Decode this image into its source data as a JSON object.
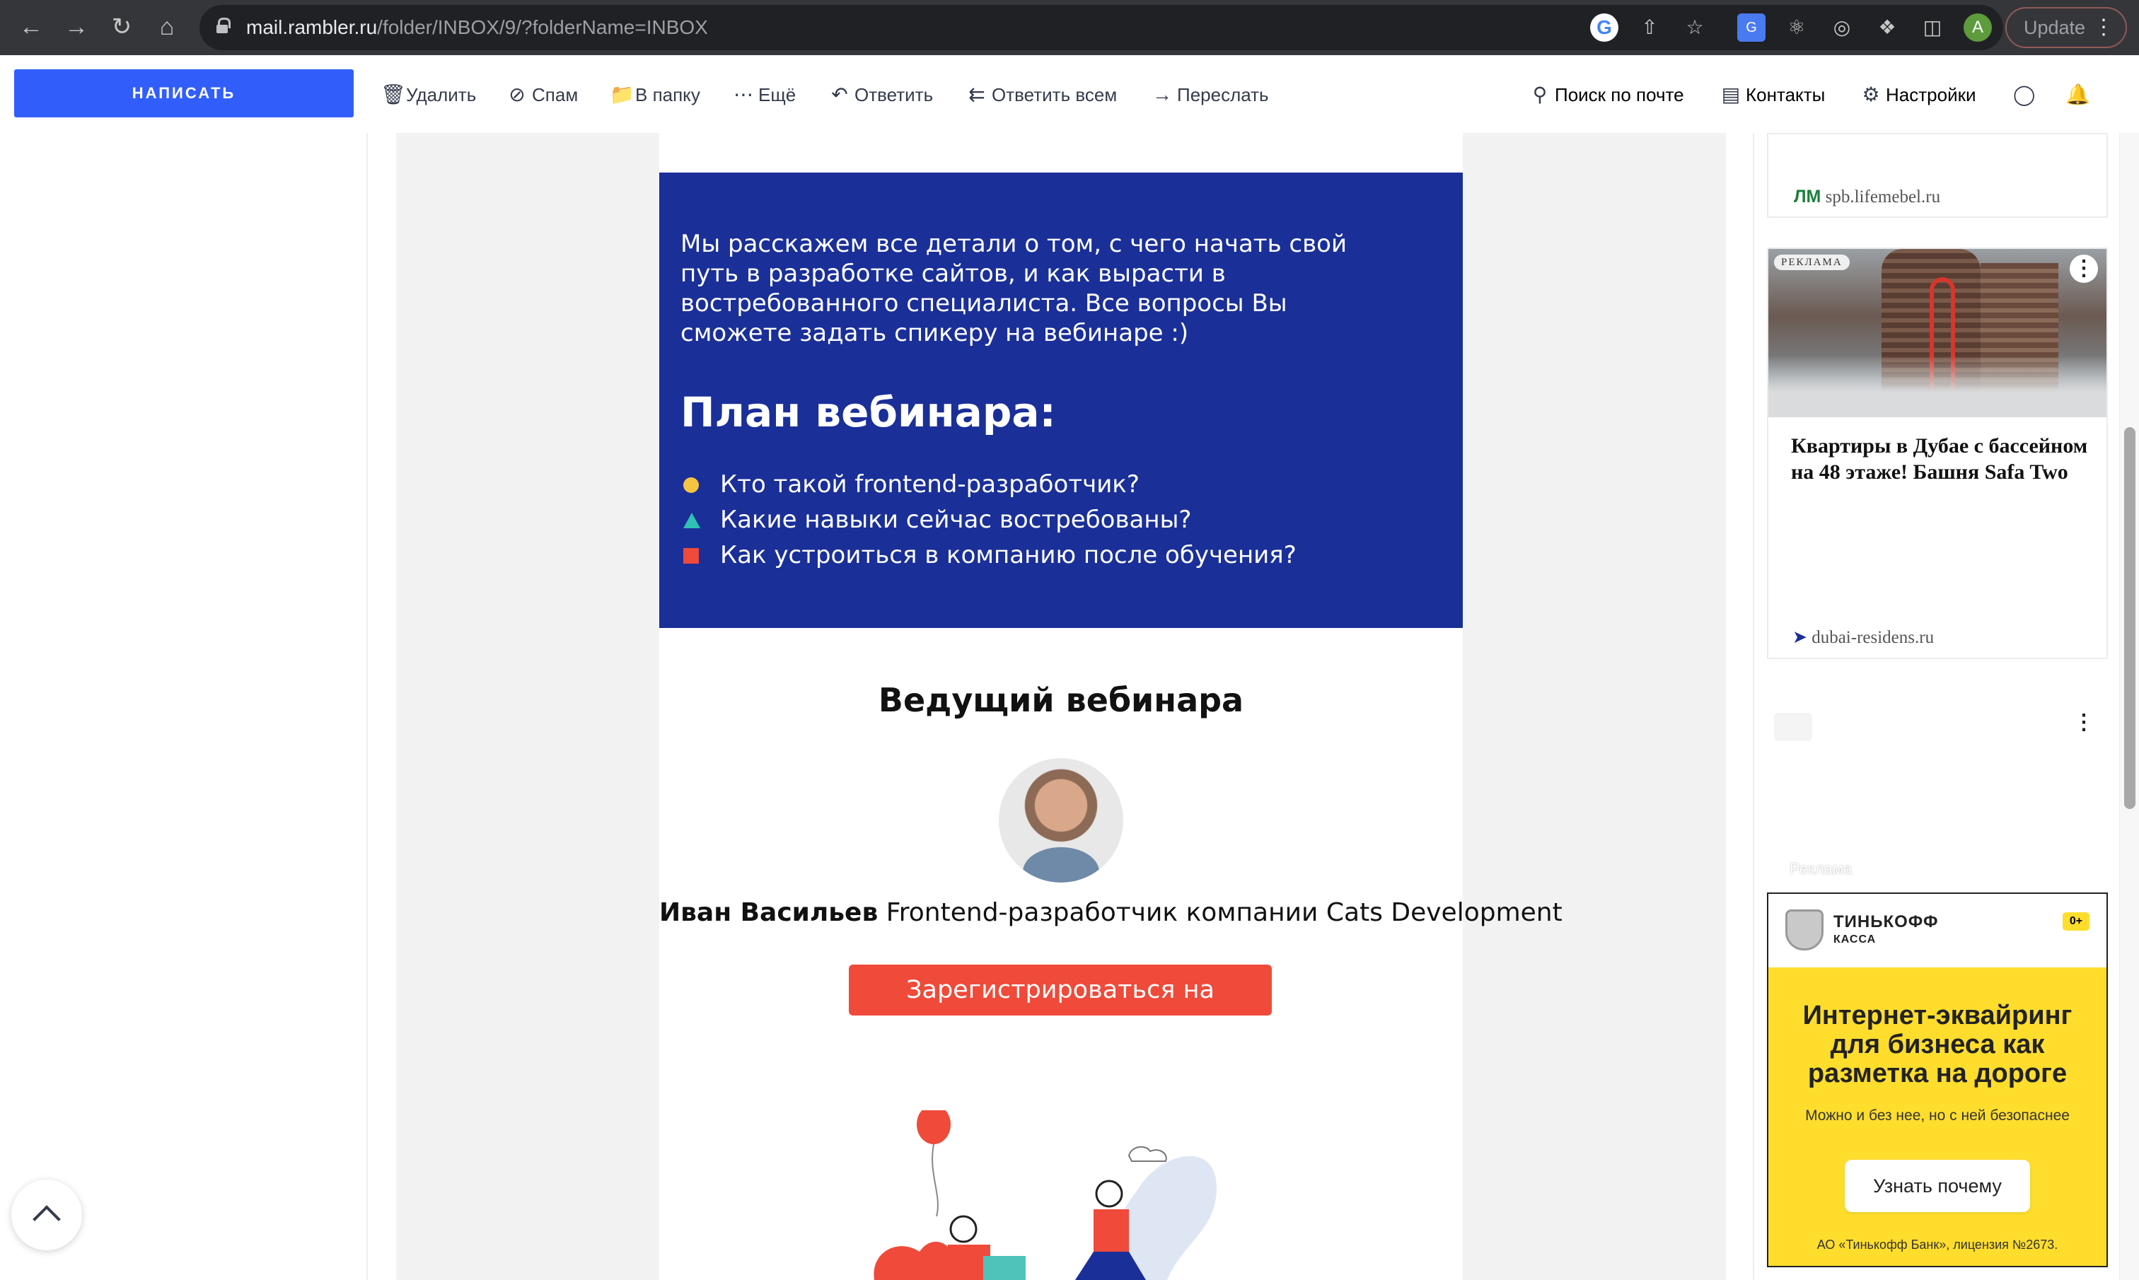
{
  "browser": {
    "url_host": "mail.rambler.ru",
    "url_path": "/folder/INBOX/9/?folderName=INBOX",
    "update_label": "Update",
    "profile_initial": "A"
  },
  "toolbar": {
    "compose_label": "НАПИСАТЬ",
    "delete_label": "Удалить",
    "spam_label": "Спам",
    "move_label": "В папку",
    "more_label": "Ещё",
    "reply_label": "Ответить",
    "reply_all_label": "Ответить всем",
    "forward_label": "Переслать",
    "search_label": "Поиск по почте",
    "contacts_label": "Контакты",
    "settings_label": "Настройки"
  },
  "letter": {
    "intro": "Мы расскажем все детали о том, с чего начать свой путь в разработке сайтов, и как вырасти в востребованного специалиста. Все вопросы Вы сможете задать спикеру на вебинаре :)",
    "plan_title": "План вебинара:",
    "plan_items": [
      "Кто такой frontend-разработчик?",
      "Какие навыки сейчас востребованы?",
      "Как устроиться в компанию после обучения?"
    ],
    "host_title": "Ведущий вебинара",
    "speaker_name": "Иван Васильев",
    "speaker_role": "Frontend-разработчик компании Cats Development",
    "register_label": "Зарегистрироваться на вебинар"
  },
  "ads": {
    "top_source": "spb.lifemebel.ru",
    "dubai_label": "РЕКЛАМА",
    "dubai_title": "Квартиры в Дубае с бассейном на 48 этаже! Башня Safa Two",
    "dubai_source": "dubai-residens.ru",
    "reklama_label": "Реклама",
    "tinkoff": {
      "brand": "ТИНЬКОФФ",
      "sub": "КАССА",
      "age": "0+",
      "headline": "Интернет-эквайринг для бизнеса как разметка на дороге",
      "note": "Можно и без нее, но с ней безопаснее",
      "cta": "Узнать почему",
      "legal": "АО «Тинькофф Банк», лицензия №2673."
    }
  },
  "colors": {
    "compose_bg": "#315efb",
    "blue_block": "#1a2f98",
    "register_btn": "#ef4a3a",
    "tinkoff_yellow": "#ffdd2d"
  }
}
